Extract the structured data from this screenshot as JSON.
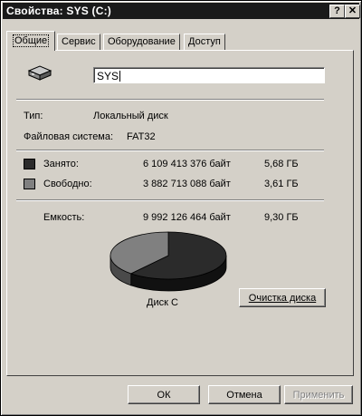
{
  "window": {
    "title": "Свойства: SYS (C:)",
    "help_glyph": "?",
    "close_glyph": "✕"
  },
  "tabs": [
    {
      "label": "Общие",
      "active": true
    },
    {
      "label": "Сервис",
      "active": false
    },
    {
      "label": "Оборудование",
      "active": false
    },
    {
      "label": "Доступ",
      "active": false
    }
  ],
  "general": {
    "drive_icon": "hard-drive-icon",
    "volume_name": "SYS",
    "type_label": "Тип:",
    "type_value": "Локальный диск",
    "fs_label": "Файловая система:",
    "fs_value": "FAT32",
    "used_label": "Занято:",
    "used_bytes": "6 109 413 376 байт",
    "used_size": "5,68 ГБ",
    "free_label": "Свободно:",
    "free_bytes": "3 882 713 088 байт",
    "free_size": "3,61 ГБ",
    "capacity_label": "Емкость:",
    "capacity_bytes": "9 992 126 464 байт",
    "capacity_size": "9,30 ГБ",
    "disk_label": "Диск C",
    "cleanup_button": "Очистка диска"
  },
  "colors": {
    "used": "#2b2b2b",
    "free": "#808080"
  },
  "chart_data": {
    "type": "pie",
    "categories": [
      "Занято",
      "Свободно"
    ],
    "values": [
      6109413376,
      3882713088
    ]
  },
  "footer": {
    "ok": "ОК",
    "cancel": "Отмена",
    "apply": "Применить"
  }
}
